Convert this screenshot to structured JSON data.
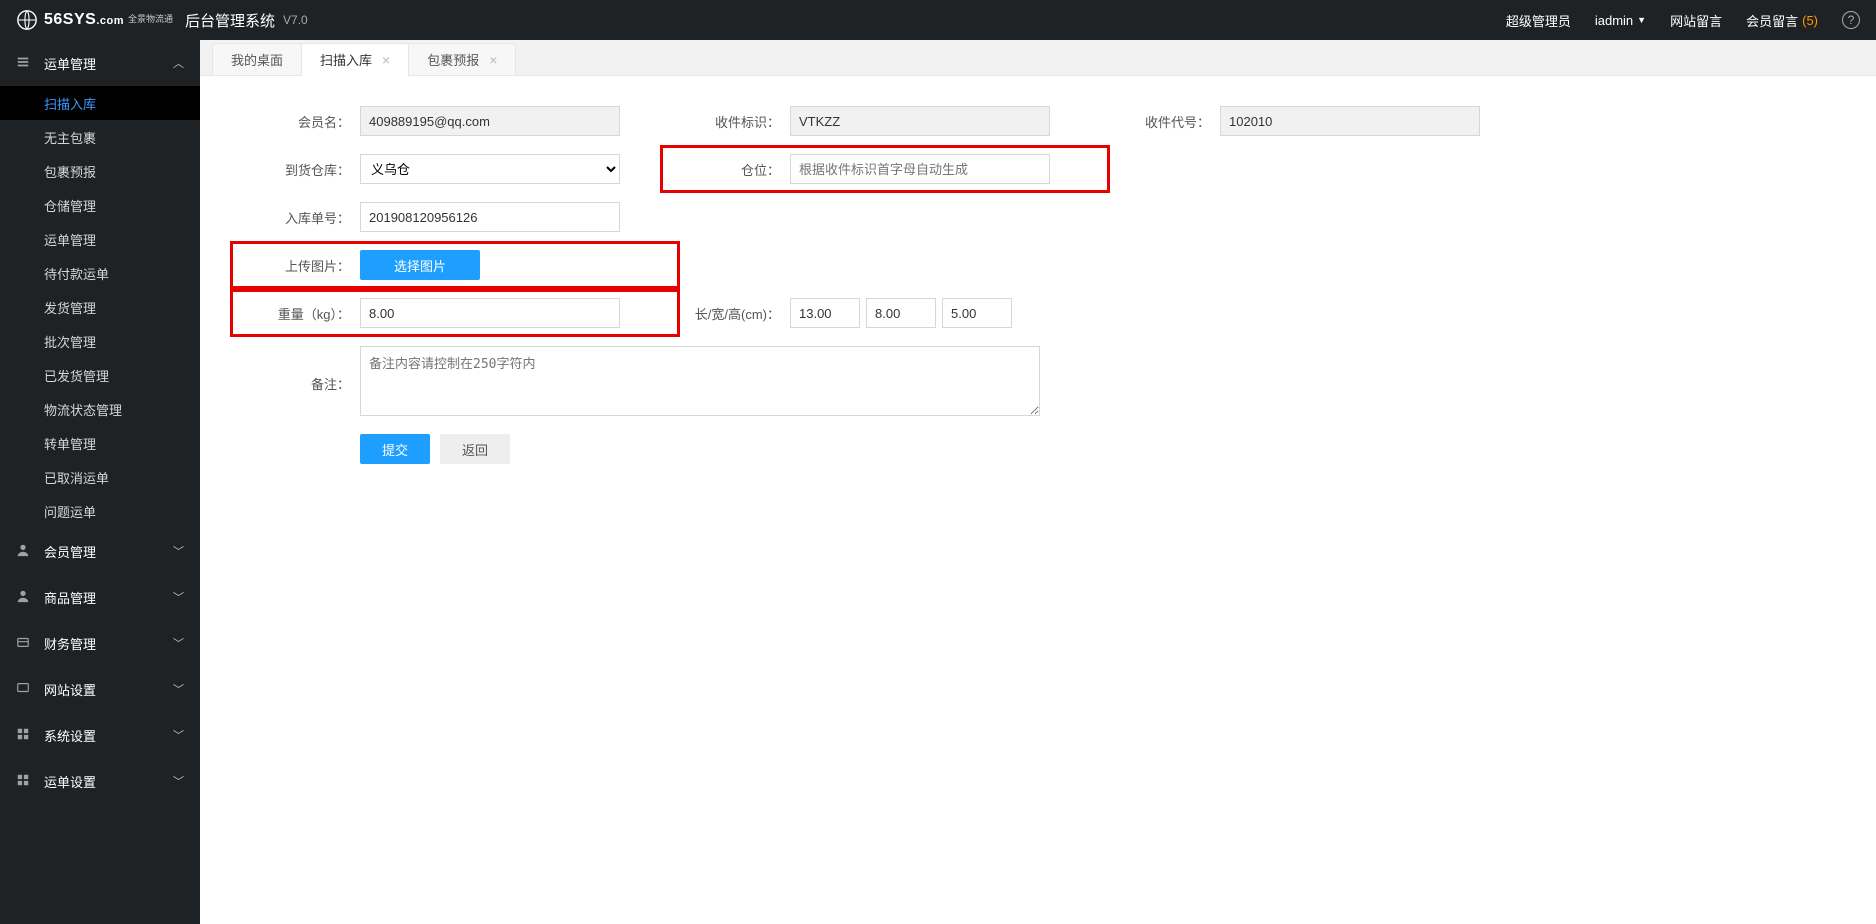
{
  "header": {
    "logo_main": "56SYS",
    "logo_suffix": ".com",
    "logo_sub1": "全景物流通",
    "sys_title": "后台管理系统",
    "version": "V7.0",
    "role": "超级管理员",
    "user": "iadmin",
    "site_msg": "网站留言",
    "member_msg": "会员留言",
    "member_msg_count": "(5)"
  },
  "sidebar": {
    "groups": [
      {
        "label": "运单管理",
        "expanded": true,
        "items": [
          "扫描入库",
          "无主包裹",
          "包裹预报",
          "仓储管理",
          "运单管理",
          "待付款运单",
          "发货管理",
          "批次管理",
          "已发货管理",
          "物流状态管理",
          "转单管理",
          "已取消运单",
          "问题运单"
        ]
      },
      {
        "label": "会员管理",
        "expanded": false
      },
      {
        "label": "商品管理",
        "expanded": false
      },
      {
        "label": "财务管理",
        "expanded": false
      },
      {
        "label": "网站设置",
        "expanded": false
      },
      {
        "label": "系统设置",
        "expanded": false
      },
      {
        "label": "运单设置",
        "expanded": false
      }
    ],
    "active_sub": "扫描入库"
  },
  "tabs": [
    {
      "label": "我的桌面",
      "closable": false,
      "active": false
    },
    {
      "label": "扫描入库",
      "closable": true,
      "active": true
    },
    {
      "label": "包裹预报",
      "closable": true,
      "active": false
    }
  ],
  "form": {
    "member_name_label": "会员名：",
    "member_name": "409889195@qq.com",
    "recv_tag_label": "收件标识：",
    "recv_tag": "VTKZZ",
    "recv_code_label": "收件代号：",
    "recv_code": "102010",
    "arrive_wh_label": "到货仓库：",
    "arrive_wh": "义乌仓",
    "slot_label": "仓位：",
    "slot_placeholder": "根据收件标识首字母自动生成",
    "inbound_no_label": "入库单号：",
    "inbound_no": "201908120956126",
    "upload_label": "上传图片：",
    "upload_btn": "选择图片",
    "weight_label": "重量（kg）：",
    "weight": "8.00",
    "dim_label": "长/宽/高(cm)：",
    "dim_l": "13.00",
    "dim_w": "8.00",
    "dim_h": "5.00",
    "remark_label": "备注：",
    "remark_placeholder": "备注内容请控制在250字符内",
    "submit": "提交",
    "back": "返回"
  }
}
